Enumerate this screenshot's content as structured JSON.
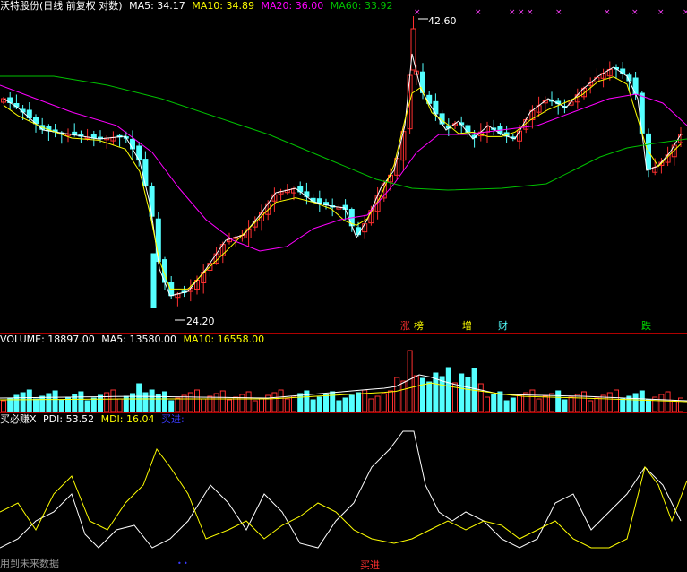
{
  "colors": {
    "up": "#ff3030",
    "down": "#54ffff",
    "ma5": "#ffffff",
    "ma10": "#ffff00",
    "ma20": "#ff00ff",
    "ma60": "#00c000",
    "pdi": "#ffffff",
    "mdi": "#ffff00",
    "signal": "#3a3aff"
  },
  "price_panel": {
    "stock": "沃特股份(日线 前复权 对数)",
    "ma5": "MA5: 34.17",
    "ma10": "MA10: 34.89",
    "ma20": "MA20: 36.00",
    "ma60": "MA60: 33.92",
    "high_label": "42.60",
    "low_label": "24.20",
    "badges": [
      "涨",
      "榜",
      "增",
      "财",
      "跌"
    ]
  },
  "volume_panel": {
    "volume": "VOLUME: 18897.00",
    "ma5": "MA5: 13580.00",
    "ma10": "MA10: 16558.00"
  },
  "indicator_panel": {
    "name": "买必赚X",
    "pdi": "PDI: 53.52",
    "mdi": "MDI: 16.04",
    "signal": "买进:",
    "buy_mark": "买进",
    "footer": "用到未来数据"
  }
}
